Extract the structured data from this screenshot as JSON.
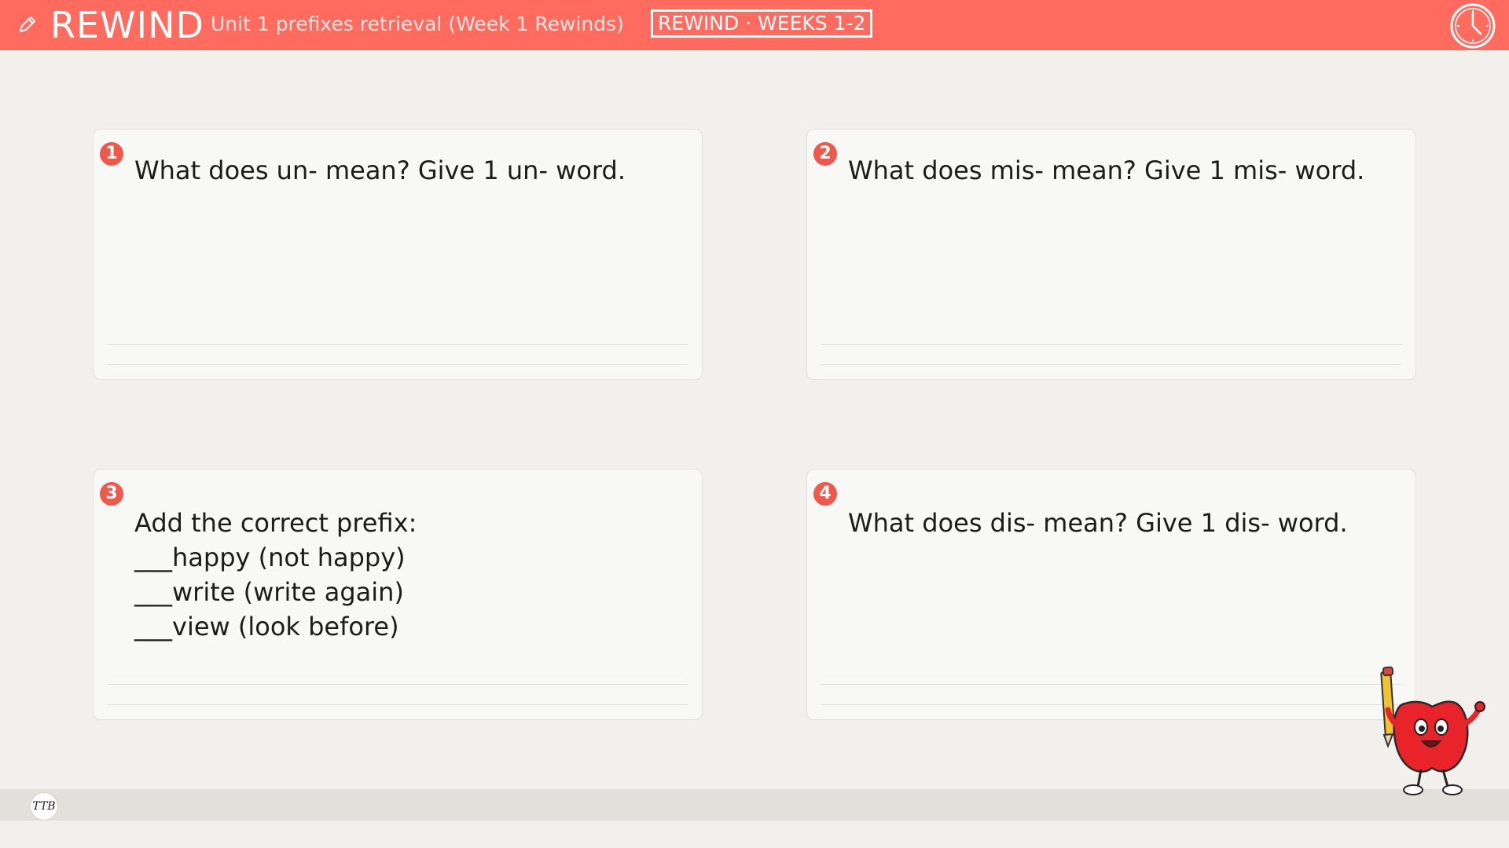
{
  "header": {
    "brand": "REWIND",
    "subtitle": "Unit 1 prefixes retrieval (Week 1 Rewinds)",
    "badge": "REWIND · WEEKS 1-2",
    "icons": [
      "pencil-icon",
      "timer-icon"
    ]
  },
  "questions": [
    {
      "number": "1",
      "text": "What does un- mean? Give 1 un- word."
    },
    {
      "number": "2",
      "text": "What does mis- mean? Give 1 mis- word."
    },
    {
      "number": "3",
      "lines": [
        "Add the correct prefix:",
        "___happy (not happy)",
        "___write (write again)",
        "___view (look before)"
      ]
    },
    {
      "number": "4",
      "text": "What does dis- mean? Give 1 dis- word."
    }
  ],
  "footer": {
    "logo_text": "TTB"
  },
  "colors": {
    "accent": "#ff6b5e",
    "badge_number": "#f0584a",
    "background": "#f2f0ec"
  }
}
